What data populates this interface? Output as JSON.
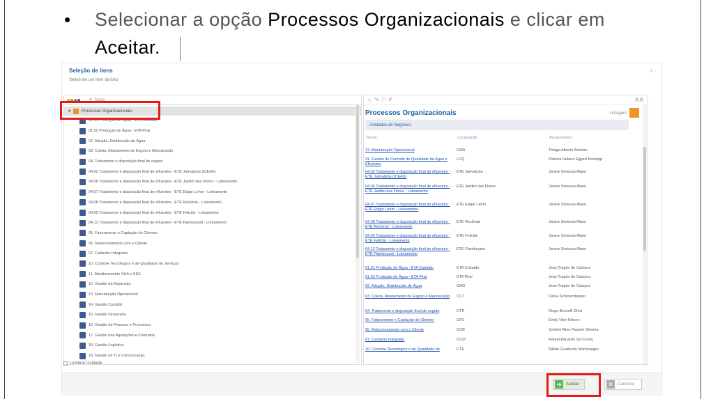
{
  "instruction": {
    "bullet": "•",
    "part1": "Selecionar a opção ",
    "bold1": "Processos Organizacionais",
    "part2": " e clicar em",
    "bold2": "Aceitar."
  },
  "dialog": {
    "title": "Seleção de itens",
    "subtitle": "Selecione um item da lista"
  },
  "left_panel": {
    "filter_label": "▼ Todas",
    "root_item": "Processos Organizacionais",
    "items": [
      "01.01 Produção de Água - ETA Cubatão",
      "01.02 Produção de Água - ETA Piraí",
      "02. Adução, Distribuição de Água",
      "03. Coleta, Afastamento de Esgoto e Manutenção",
      "04. Tratamento e disposição final de esgoto",
      "04.02 Tratamento e disposição final de efluentes - ETE Jarivatuba (ICEAS)",
      "04.06 Tratamento e disposição final de efluentes - ETE Jardim das Flores - Loteamento",
      "04.07 Tratamento e disposição final de efluentes - ETE Edgar Lehm - Loteamento",
      "04.08 Tratamento e disposição final de efluentes - ETE Reclimat - Loteamento",
      "04.09 Tratamento e disposição final de efluentes - ETE Felicitá - Loteamento",
      "04.12 Tratamento e disposição final de efluentes - ETE Flamboyant - Loteamento",
      "05. Faturamento e Captação de Clientes",
      "06. Relacionamento com o Cliente",
      "07. Cadastro Integrado",
      "10. Controle Tecnológico e de Qualidade de Serviços",
      "11. Monitoramento SAA e SES",
      "12. Gestão da Expansão",
      "13. Manutenção Operacional",
      "14. Gestão Contábil",
      "15. Gestão Financeira",
      "16. Gestão de Pessoas e Processos",
      "17. Gestão das Aquisições e Contratos",
      "18. Gestão Logística",
      "19. Gestão de TI e Comunicação"
    ],
    "remember_label": "Lembrar Unidade"
  },
  "right_panel": {
    "title": "Processos Organizacionais",
    "listagem": "Listagem",
    "section": "Unidades de Negócios",
    "headers": [
      "Nome",
      "Localização",
      "Responsável"
    ],
    "rows": [
      [
        "13. Manutenção Operacional",
        "GMS",
        "Thiago Alberto Amorim"
      ],
      [
        "31. Gestão do Controle de Qualidade da Água e Efluentes",
        "LCQ",
        "Patricia Helena Eggert Kamopp"
      ],
      [
        "04.02 Tratamento e disposição final de efluentes - ETE Jarivatuba (ICEAS)",
        "ETE Jarivatuba",
        "Janine Simiania Alano"
      ],
      [
        "04.06 Tratamento e disposição final de efluentes - ETE Jardim das Flores - Loteamento",
        "ETE Jardim das Flores",
        "Janine Simiania Alano"
      ],
      [
        "04.07 Tratamento e disposição final de efluentes - ETE Edgar Lehm - Loteamento",
        "ETE Edgar Lehm",
        "Janine Simiania Alano"
      ],
      [
        "04.08 Tratamento e disposição final de efluentes - ETE Reclimat - Loteamento",
        "ETE Reclimat",
        "Janine Simiania Alano"
      ],
      [
        "04.09 Tratamento e disposição final de efluentes - ETE Felicitá - Loteamento",
        "ETE Felicitá",
        "Janine Simiania Alano"
      ],
      [
        "04.12 Tratamento e disposição final de efluentes - ETE Flamboyant - Loteamento",
        "ETE Flamboyant",
        "Janine Simiania Alano"
      ],
      [
        "01.01 Produção de Água - ETA Cubatão",
        "ETA Cubatão",
        "Jean Tragbo de Campos"
      ],
      [
        "01.02 Produção de Água - ETA Piraí",
        "ETA Piraí",
        "Jean Tragbo de Campos"
      ],
      [
        "02. Adução, Distribuição de Água",
        "GAG",
        "Jean Tragbo de Campos"
      ],
      [
        "03. Coleta, Afastamento de Esgoto e Manutenção",
        "CCT",
        "Dalva Schroemberger"
      ],
      [
        "04. Tratamento e disposição final de esgoto",
        "CTR",
        "Diego Brunelli Ghisi"
      ],
      [
        "05. Faturamento e Captação de Clientes",
        "GFC",
        "Emily Vitor Fritzen"
      ],
      [
        "06. Relacionamento com o Cliente",
        "CCR",
        "Schirlei Aline Pasche Oliveira"
      ],
      [
        "07. Cadastro Integrado",
        "CICP",
        "Rafael Eduardo da Cunha"
      ],
      [
        "10. Controle Tecnológico e de Qualidade de",
        "CTE",
        "Sibele Gualberto Montenegro"
      ]
    ]
  },
  "footer": {
    "accept": "Aceitar",
    "cancel": "Cancelar"
  },
  "colors": {
    "highlight": "#e21a1a",
    "link": "#1f4fb0",
    "accent": "#f29520"
  }
}
